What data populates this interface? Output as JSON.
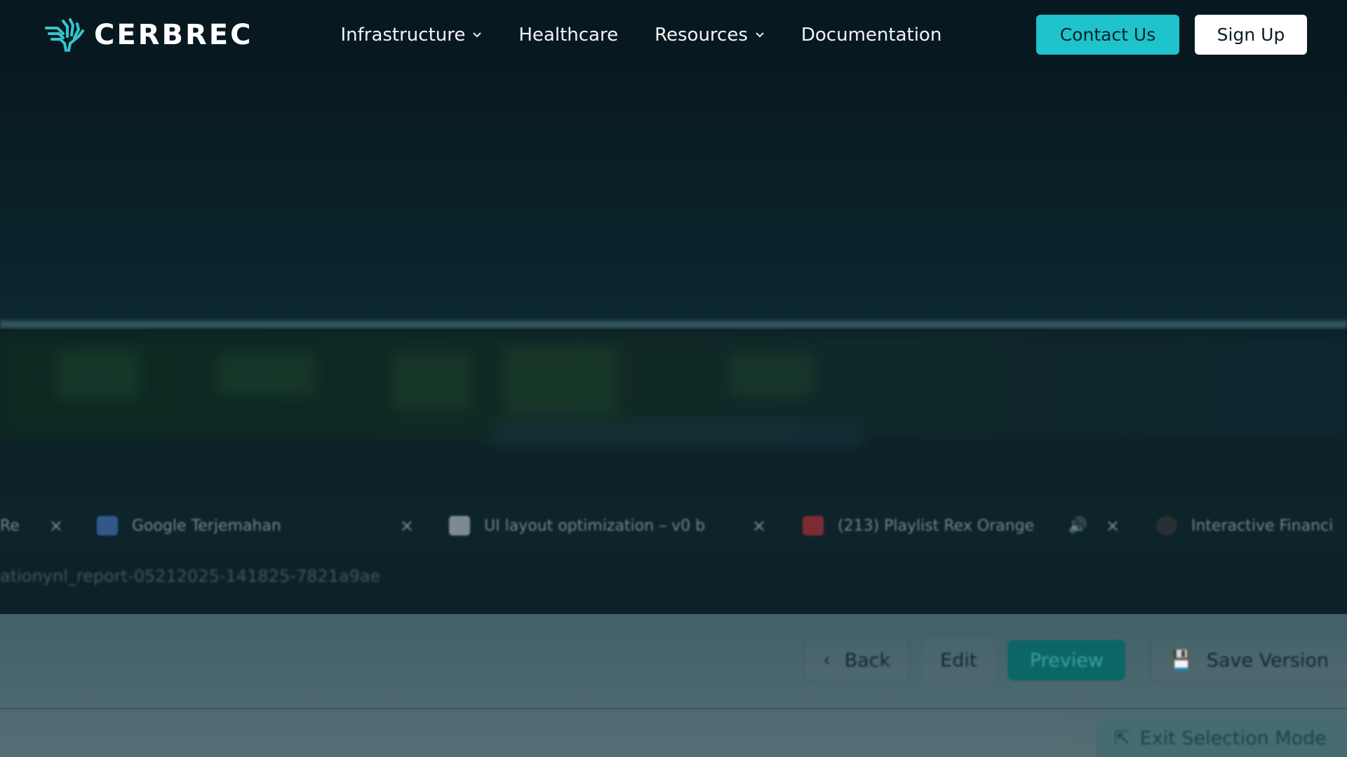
{
  "brand": {
    "name": "CERBREC",
    "accent_color": "#1ec3cb"
  },
  "nav": {
    "items": [
      {
        "label": "Infrastructure",
        "has_dropdown": true
      },
      {
        "label": "Healthcare",
        "has_dropdown": false
      },
      {
        "label": "Resources",
        "has_dropdown": true
      },
      {
        "label": "Documentation",
        "has_dropdown": false
      }
    ],
    "contact_label": "Contact Us",
    "signup_label": "Sign Up"
  },
  "background_browser": {
    "tabs": [
      {
        "title": "Re",
        "icon": "generic-tab-icon"
      },
      {
        "title": "Google Terjemahan",
        "icon": "translate-icon"
      },
      {
        "title": "UI layout optimization – v0 b",
        "icon": "v0-icon"
      },
      {
        "title": "(213) Playlist Rex Orange",
        "icon": "youtube-icon",
        "audio": true
      },
      {
        "title": "Interactive Financi",
        "icon": "generic-tab-icon"
      }
    ],
    "close_glyph": "×",
    "address_text": "ationynl_report-05212025-141825-7821a9ae"
  },
  "editor_toolbar": {
    "back_label": "Back",
    "edit_label": "Edit",
    "preview_label": "Preview",
    "save_label": "Save Version",
    "exit_selection_label": "Exit Selection Mode"
  }
}
